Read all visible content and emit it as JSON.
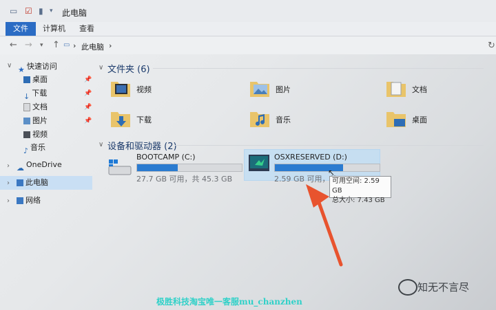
{
  "window": {
    "title": "此电脑"
  },
  "ribbon": {
    "tabs": [
      {
        "label": "文件"
      },
      {
        "label": "计算机"
      },
      {
        "label": "查看"
      }
    ]
  },
  "address": {
    "breadcrumb": "此电脑",
    "separator": "›"
  },
  "sidebar": {
    "quick_access": "快速访问",
    "items": [
      {
        "label": "桌面"
      },
      {
        "label": "下载"
      },
      {
        "label": "文档"
      },
      {
        "label": "图片"
      },
      {
        "label": "视频"
      },
      {
        "label": "音乐"
      }
    ],
    "onedrive": "OneDrive",
    "this_pc": "此电脑",
    "network": "网络"
  },
  "folders_section": {
    "title": "文件夹 (6)",
    "folders": [
      {
        "label": "视频"
      },
      {
        "label": "图片"
      },
      {
        "label": "文档"
      },
      {
        "label": "下载"
      },
      {
        "label": "音乐"
      },
      {
        "label": "桌面"
      }
    ]
  },
  "devices_section": {
    "title": "设备和驱动器 (2)",
    "drives": [
      {
        "label": "BOOTCAMP (C:)",
        "status": "27.7 GB 可用，共 45.3 GB",
        "used_fraction": 0.39
      },
      {
        "label": "OSXRESERVED (D:)",
        "status": "2.59 GB 可用，共 7.43 GB",
        "used_fraction": 0.65
      }
    ]
  },
  "tooltip": {
    "line1": "可用空间: 2.59 GB",
    "line2": "总大小: 7.43 GB"
  },
  "watermark": {
    "text": "知无不言尽"
  },
  "bottom_text": "极胜科技淘宝唯一客服mu_chanzhen",
  "colors": {
    "accent": "#2b6cc4",
    "drive_fill": "#2a7bd0",
    "arrow": "#e8532e"
  }
}
